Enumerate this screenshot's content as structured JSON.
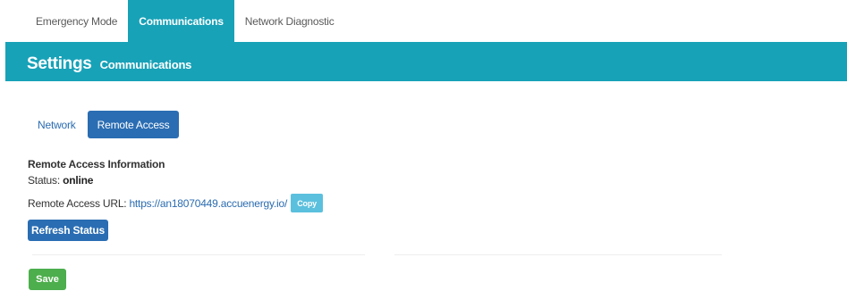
{
  "top_tabs": [
    {
      "label": "Emergency Mode"
    },
    {
      "label": "Communications"
    },
    {
      "label": "Network Diagnostic"
    }
  ],
  "banner": {
    "title": "Settings",
    "subtitle": "Communications"
  },
  "sub_tabs": [
    {
      "label": "Network"
    },
    {
      "label": "Remote Access"
    }
  ],
  "remote_access": {
    "section_title": "Remote Access Information",
    "status_label": "Status:",
    "status_value": "online",
    "url_label": "Remote Access URL:",
    "url_value": "https://an18070449.accuenergy.io/",
    "copy_label": "Copy",
    "refresh_label": "Refresh Status"
  },
  "footer": {
    "save_label": "Save"
  },
  "colors": {
    "accent": "#17a2b8",
    "primary": "#2a6db3",
    "info": "#5bc0de",
    "success": "#4cae4c"
  }
}
